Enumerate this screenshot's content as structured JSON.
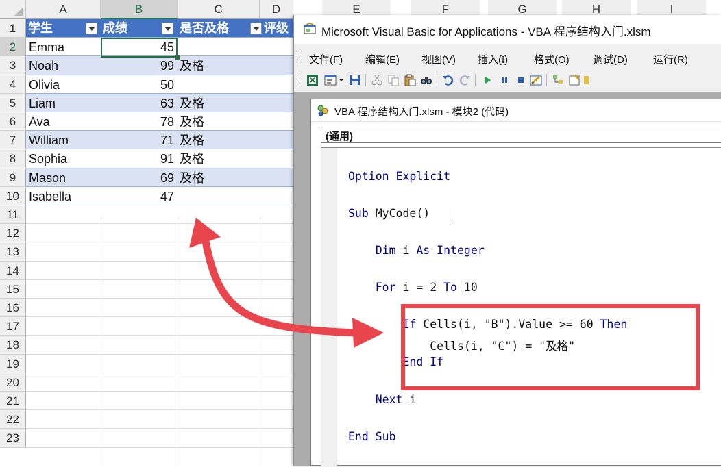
{
  "excel": {
    "columns": [
      "A",
      "B",
      "C",
      "D",
      "E",
      "F",
      "G",
      "H",
      "I"
    ],
    "selected_column": "B",
    "rows": [
      "1",
      "2",
      "3",
      "4",
      "5",
      "6",
      "7",
      "8",
      "9",
      "10",
      "11",
      "12",
      "13",
      "14",
      "15",
      "16",
      "17",
      "18",
      "19",
      "20",
      "21",
      "22",
      "23"
    ],
    "selected_row": "2",
    "table_headers": [
      "学生",
      "成绩",
      "是否及格",
      "评级"
    ],
    "table_rows": [
      {
        "name": "Emma",
        "score": "45",
        "pass": ""
      },
      {
        "name": "Noah",
        "score": "99",
        "pass": "及格"
      },
      {
        "name": "Olivia",
        "score": "50",
        "pass": ""
      },
      {
        "name": "Liam",
        "score": "63",
        "pass": "及格"
      },
      {
        "name": "Ava",
        "score": "78",
        "pass": "及格"
      },
      {
        "name": "William",
        "score": "71",
        "pass": "及格"
      },
      {
        "name": "Sophia",
        "score": "91",
        "pass": "及格"
      },
      {
        "name": "Mason",
        "score": "69",
        "pass": "及格"
      },
      {
        "name": "Isabella",
        "score": "47",
        "pass": ""
      }
    ],
    "colors": {
      "header_fill": "#4472c4",
      "band_fill": "#dbe2f3",
      "selection": "#217346"
    }
  },
  "vbe": {
    "title": "Microsoft Visual Basic for Applications - VBA 程序结构入门.xlsm",
    "menus": [
      "文件(F)",
      "编辑(E)",
      "视图(V)",
      "插入(I)",
      "格式(O)",
      "调试(D)",
      "运行(R)"
    ],
    "toolbar_icons": [
      "excel-icon",
      "insert-form-icon",
      "save-icon",
      "cut-icon",
      "copy-icon",
      "paste-icon",
      "find-icon",
      "undo-icon",
      "redo-icon",
      "run-icon",
      "break-icon",
      "reset-icon",
      "design-mode-icon",
      "project-explorer-icon",
      "properties-icon",
      "object-browser-icon"
    ],
    "code_window": {
      "title": "VBA 程序结构入门.xlsm - 模块2 (代码)",
      "object_box": "(通用)",
      "lines": [
        {
          "pre": "",
          "kw": "Option Explicit",
          "post": ""
        },
        {
          "pre": "",
          "kw": "Sub",
          "post": " MyCode()"
        },
        {
          "pre": "    ",
          "kw": "Dim",
          "post": " i ",
          "kw2": "As Integer"
        },
        {
          "pre": "    ",
          "kw": "For",
          "post": " i = 2 ",
          "kw2": "To",
          "post2": " 10"
        },
        {
          "pre": "        ",
          "kw": "If",
          "post": " Cells(i, \"B\").Value >= 60 ",
          "kw2": "Then"
        },
        {
          "pre": "            ",
          "kw": "",
          "post": "Cells(i, \"C\") = \"及格\""
        },
        {
          "pre": "        ",
          "kw": "End If",
          "post": ""
        },
        {
          "pre": "    ",
          "kw": "Next",
          "post": " i"
        },
        {
          "pre": "",
          "kw": "End Sub",
          "post": ""
        }
      ]
    }
  },
  "annotation": {
    "color": "#e8454d"
  }
}
